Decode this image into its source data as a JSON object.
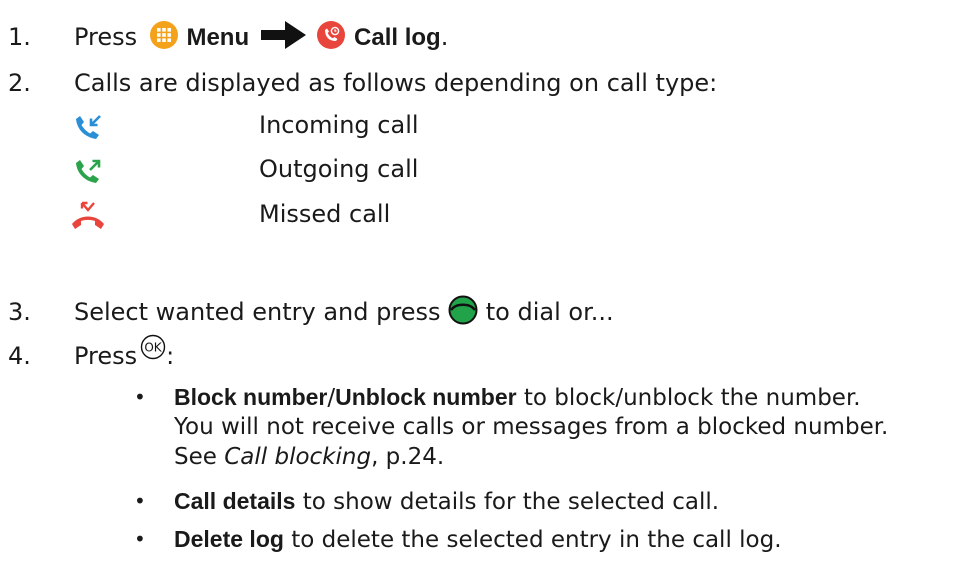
{
  "steps": [
    {
      "number": "1.",
      "press": "Press",
      "menu_label": "Menu",
      "calllog_label": "Call log",
      "period": "."
    },
    {
      "number": "2.",
      "text": "Calls are displayed as follows depending on call type:"
    },
    {
      "number": "3.",
      "text_before": "Select wanted entry and press",
      "text_after": "to dial or..."
    },
    {
      "number": "4.",
      "press": "Press",
      "colon": ":"
    }
  ],
  "call_types": [
    {
      "icon": "incoming-call-icon",
      "color": "#2a8fd6",
      "label": "Incoming call"
    },
    {
      "icon": "outgoing-call-icon",
      "color": "#2aa34a",
      "label": "Outgoing call"
    },
    {
      "icon": "missed-call-icon",
      "color": "#e8453c",
      "label": "Missed call"
    }
  ],
  "options": [
    {
      "bold": "Block number",
      "slash": "/",
      "bold2": "Unblock number",
      "text": " to block/unblock the number.",
      "line2": "You will not receive calls or messages from a blocked number.",
      "see": "See ",
      "ref": "Call blocking",
      "page": ", p.24."
    },
    {
      "bold": "Call details",
      "text": " to show details for the selected call."
    },
    {
      "bold": "Delete log",
      "text": " to delete the selected entry in the call log."
    }
  ],
  "bullet": "•",
  "colors": {
    "menu_icon": "#f4a21c",
    "calllog_icon": "#e8453c",
    "dial_key": "#22a34a"
  }
}
